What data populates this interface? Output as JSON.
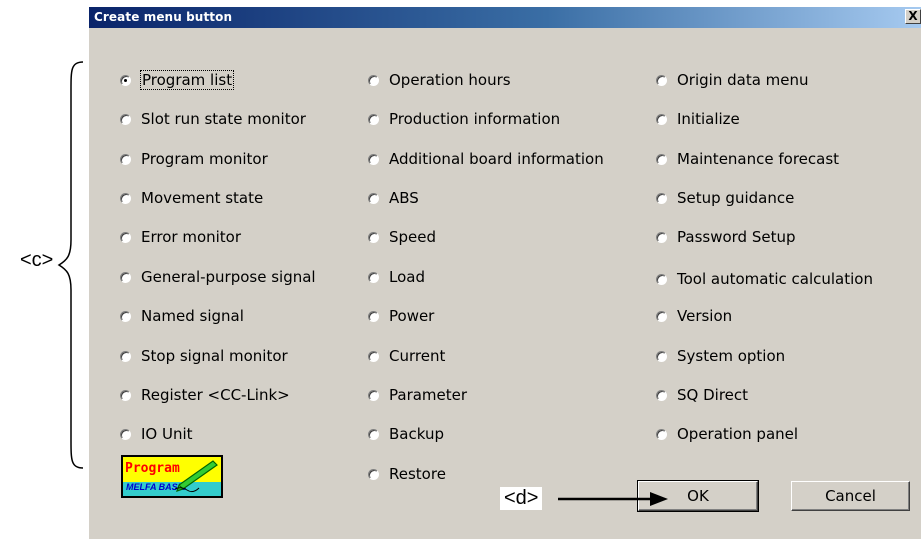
{
  "window": {
    "title": "Create menu button",
    "close_label": "X"
  },
  "options": {
    "col1": [
      {
        "label": "Program list",
        "checked": true
      },
      {
        "label": "Slot run state monitor",
        "checked": false
      },
      {
        "label": "Program monitor",
        "checked": false
      },
      {
        "label": "Movement state",
        "checked": false
      },
      {
        "label": "Error monitor",
        "checked": false
      },
      {
        "label": "General-purpose signal",
        "checked": false
      },
      {
        "label": "Named signal",
        "checked": false
      },
      {
        "label": "Stop signal monitor",
        "checked": false
      },
      {
        "label": "Register <CC-Link>",
        "checked": false
      },
      {
        "label": "IO Unit",
        "checked": false
      }
    ],
    "col2": [
      {
        "label": "Operation hours",
        "checked": false
      },
      {
        "label": "Production information",
        "checked": false
      },
      {
        "label": "Additional board information",
        "checked": false
      },
      {
        "label": "ABS",
        "checked": false
      },
      {
        "label": "Speed",
        "checked": false
      },
      {
        "label": "Load",
        "checked": false
      },
      {
        "label": "Power",
        "checked": false
      },
      {
        "label": "Current",
        "checked": false
      },
      {
        "label": "Parameter",
        "checked": false
      },
      {
        "label": "Backup",
        "checked": false
      },
      {
        "label": "Restore",
        "checked": false
      }
    ],
    "col3": [
      {
        "label": "Origin data menu",
        "checked": false
      },
      {
        "label": "Initialize",
        "checked": false
      },
      {
        "label": "Maintenance forecast",
        "checked": false
      },
      {
        "label": "Setup guidance",
        "checked": false
      },
      {
        "label": "Password Setup",
        "checked": false
      },
      {
        "label": "Tool automatic calculation",
        "checked": false
      },
      {
        "label": "Version",
        "checked": false
      },
      {
        "label": "System option",
        "checked": false
      },
      {
        "label": "SQ Direct",
        "checked": false
      },
      {
        "label": "Operation panel",
        "checked": false
      }
    ]
  },
  "logo": {
    "word1": "Program",
    "word2": "MELFA BASIC"
  },
  "buttons": {
    "ok": "OK",
    "cancel": "Cancel"
  },
  "annotations": {
    "c": "<c>",
    "d": "<d>"
  },
  "colors": {
    "dialog_bg": "#d4d0c8",
    "titlebar_start": "#0a246a",
    "titlebar_end": "#a6caf0",
    "logo_top": "#ffff00",
    "logo_bottom": "#33cccc"
  },
  "icons": [
    "close-icon",
    "radio-button",
    "pen-icon",
    "bracket-annotation",
    "arrow-annotation"
  ]
}
